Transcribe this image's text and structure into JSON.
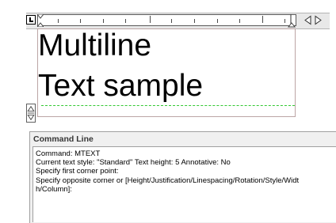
{
  "ruler": {
    "tab_selector_icon": "left-tab-icon",
    "indent_icon": "indent-marker-icon",
    "width_handle_icon": "width-handle-icon",
    "width_arrows_icon": "width-resize-arrows-icon"
  },
  "editor": {
    "lines": [
      "Multiline",
      "Text sample"
    ],
    "height_handle_icon": "height-resize-arrows-icon",
    "baseline_color": "#32c832"
  },
  "command_line": {
    "title": "Command Line",
    "history": [
      "Command: MTEXT",
      "Current text style:  \"Standard\"  Text height:  5  Annotative:  No",
      "Specify first corner point:",
      "Specify opposite corner or [Height/Justification/Linespacing/Rotation/Style/Widt",
      "h/Column]:"
    ],
    "input_value": ""
  }
}
